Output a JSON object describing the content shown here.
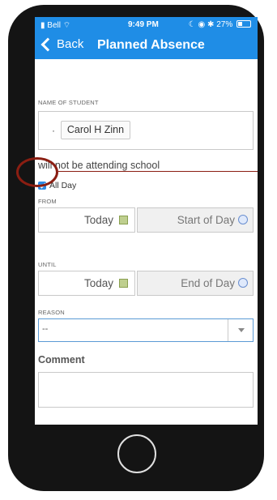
{
  "status_bar": {
    "carrier": "Bell",
    "time": "9:49 PM",
    "battery": "27%"
  },
  "nav": {
    "back_label": "Back",
    "title": "Planned Absence"
  },
  "form": {
    "student_label": "NAME OF STUDENT",
    "student_name": "Carol H Zinn",
    "attending_text": "will not be attending school",
    "all_day_label": "All Day",
    "all_day_checked": true,
    "from_label": "FROM",
    "from_date": "Today",
    "from_time": "Start of Day",
    "until_label": "UNTIL",
    "until_date": "Today",
    "until_time": "End of Day",
    "reason_label": "REASON",
    "reason_value": "--",
    "comment_label": "Comment",
    "comment_value": ""
  },
  "colors": {
    "accent": "#1f8de6",
    "annotation": "#8b1e12",
    "phone_body": "#141414"
  }
}
